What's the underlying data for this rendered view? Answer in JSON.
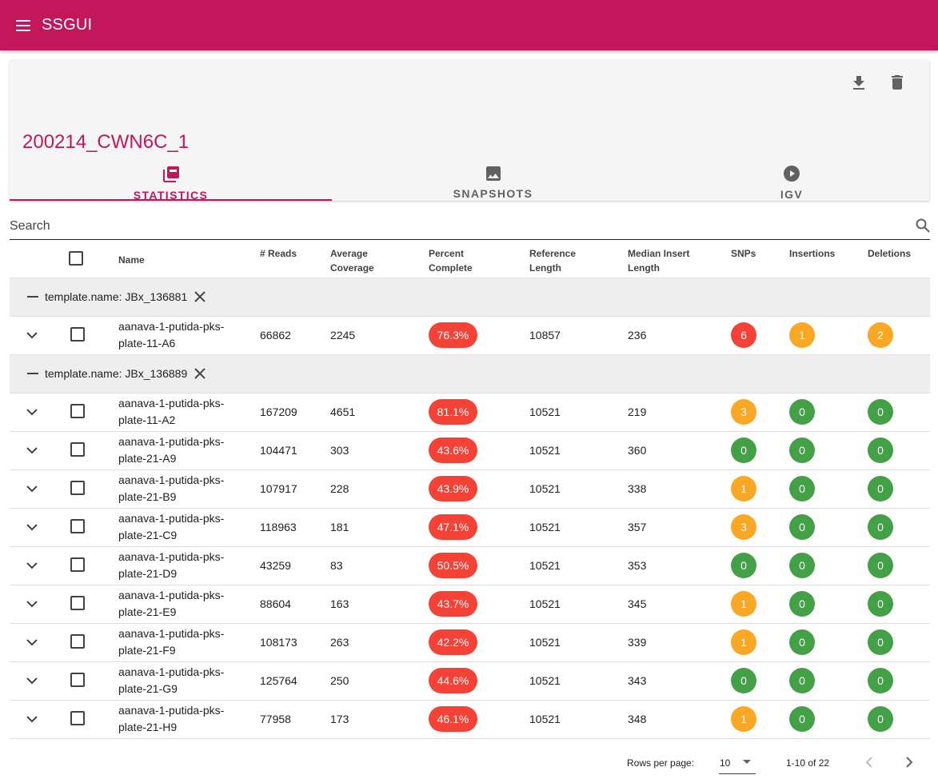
{
  "app": {
    "title": "SSGUI",
    "accent": "#c2185b"
  },
  "run": {
    "title": "200214_CWN6C_1"
  },
  "tabs": [
    {
      "label": "STATISTICS",
      "icon": "library-icon",
      "active": true
    },
    {
      "label": "SNAPSHOTS",
      "icon": "image-icon",
      "active": false
    },
    {
      "label": "IGV",
      "icon": "play-circle-icon",
      "active": false
    }
  ],
  "search": {
    "placeholder": "Search"
  },
  "table": {
    "headers": {
      "name": "Name",
      "reads": "# Reads",
      "coverage": "Average Coverage",
      "percent": "Percent Complete",
      "ref_length": "Reference Length",
      "median_insert": "Median Insert Length",
      "snps": "SNPs",
      "insertions": "Insertions",
      "deletions": "Deletions"
    },
    "groups": [
      {
        "label": "template.name: JBx_136881",
        "rows": [
          {
            "name": "aanava-1-putida-pks-plate-11-A6",
            "reads": "66862",
            "coverage": "2245",
            "percent": "76.3%",
            "ref_length": "10857",
            "median_insert": "236",
            "snps": "6",
            "insertions": "1",
            "deletions": "2"
          }
        ]
      },
      {
        "label": "template.name: JBx_136889",
        "rows": [
          {
            "name": "aanava-1-putida-pks-plate-11-A2",
            "reads": "167209",
            "coverage": "4651",
            "percent": "81.1%",
            "ref_length": "10521",
            "median_insert": "219",
            "snps": "3",
            "insertions": "0",
            "deletions": "0"
          },
          {
            "name": "aanava-1-putida-pks-plate-21-A9",
            "reads": "104471",
            "coverage": "303",
            "percent": "43.6%",
            "ref_length": "10521",
            "median_insert": "360",
            "snps": "0",
            "insertions": "0",
            "deletions": "0"
          },
          {
            "name": "aanava-1-putida-pks-plate-21-B9",
            "reads": "107917",
            "coverage": "228",
            "percent": "43.9%",
            "ref_length": "10521",
            "median_insert": "338",
            "snps": "1",
            "insertions": "0",
            "deletions": "0"
          },
          {
            "name": "aanava-1-putida-pks-plate-21-C9",
            "reads": "118963",
            "coverage": "181",
            "percent": "47.1%",
            "ref_length": "10521",
            "median_insert": "357",
            "snps": "3",
            "insertions": "0",
            "deletions": "0"
          },
          {
            "name": "aanava-1-putida-pks-plate-21-D9",
            "reads": "43259",
            "coverage": "83",
            "percent": "50.5%",
            "ref_length": "10521",
            "median_insert": "353",
            "snps": "0",
            "insertions": "0",
            "deletions": "0"
          },
          {
            "name": "aanava-1-putida-pks-plate-21-E9",
            "reads": "88604",
            "coverage": "163",
            "percent": "43.7%",
            "ref_length": "10521",
            "median_insert": "345",
            "snps": "1",
            "insertions": "0",
            "deletions": "0"
          },
          {
            "name": "aanava-1-putida-pks-plate-21-F9",
            "reads": "108173",
            "coverage": "263",
            "percent": "42.2%",
            "ref_length": "10521",
            "median_insert": "339",
            "snps": "1",
            "insertions": "0",
            "deletions": "0"
          },
          {
            "name": "aanava-1-putida-pks-plate-21-G9",
            "reads": "125764",
            "coverage": "250",
            "percent": "44.6%",
            "ref_length": "10521",
            "median_insert": "343",
            "snps": "0",
            "insertions": "0",
            "deletions": "0"
          },
          {
            "name": "aanava-1-putida-pks-plate-21-H9",
            "reads": "77958",
            "coverage": "173",
            "percent": "46.1%",
            "ref_length": "10521",
            "median_insert": "348",
            "snps": "1",
            "insertions": "0",
            "deletions": "0"
          }
        ]
      }
    ]
  },
  "footer": {
    "rows_per_page_label": "Rows per page:",
    "rows_per_page": "10",
    "range": "1-10 of 22"
  },
  "colors": {
    "red": "#f44336",
    "orange": "#f9a825",
    "green": "#43a047"
  }
}
